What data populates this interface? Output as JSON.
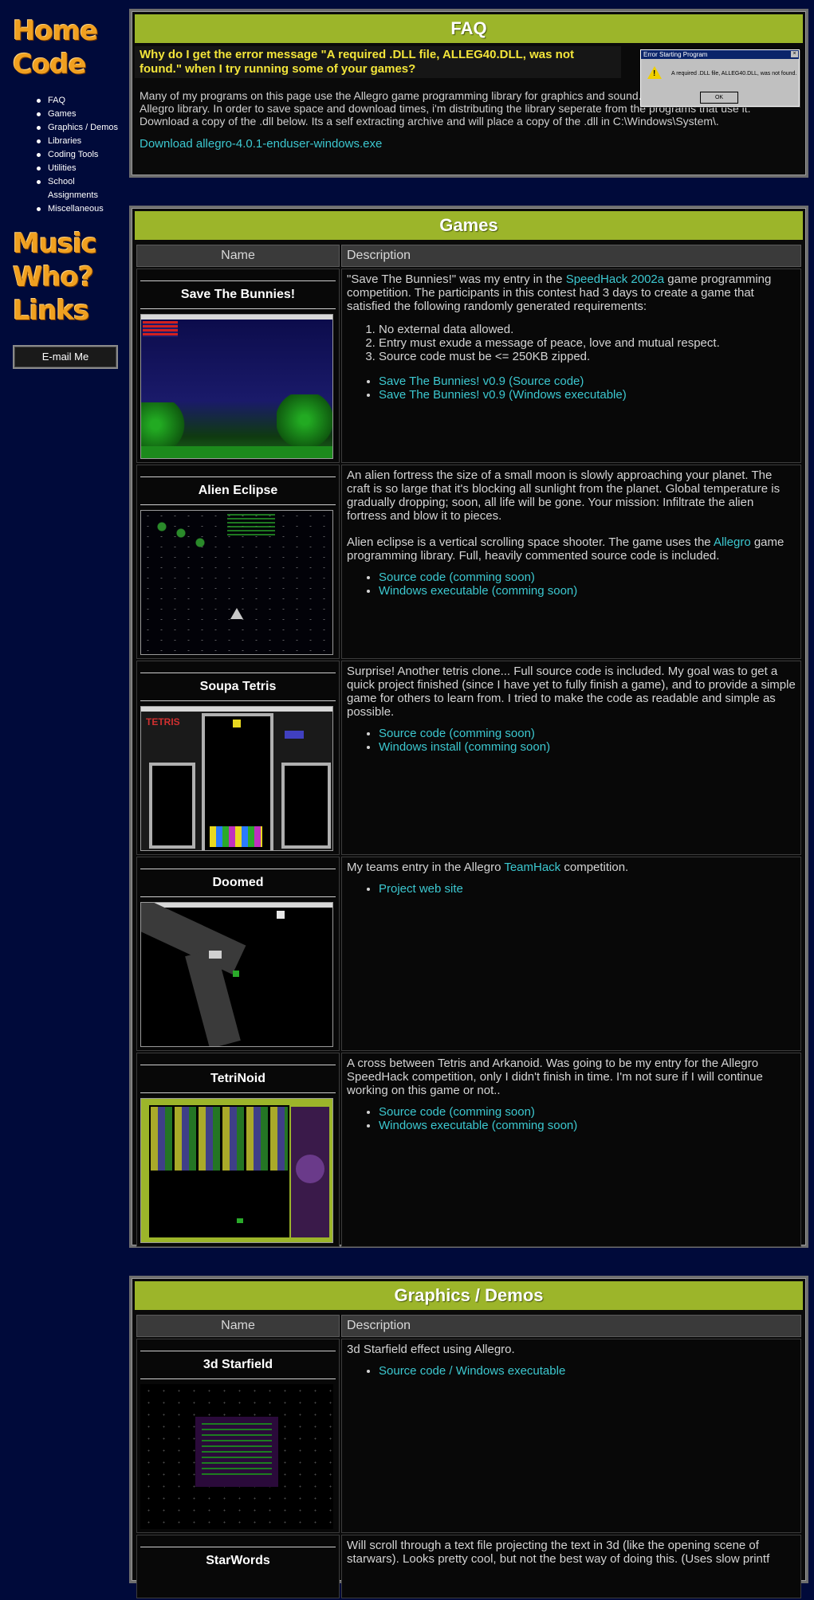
{
  "sidebar": {
    "logo_items": [
      "Home",
      "Code"
    ],
    "sub_items": [
      "FAQ",
      "Games",
      "Graphics / Demos",
      "Libraries",
      "Coding Tools",
      "Utilities",
      "School Assignments",
      "Miscellaneous"
    ],
    "logo_items2": [
      "Music",
      "Who?",
      "Links"
    ],
    "email_label": "E-mail Me"
  },
  "faq": {
    "header": "FAQ",
    "question": "Why do I get the error message \"A required .DLL file, ALLEG40.DLL, was not found.\" when I try running some of your games?",
    "answer": "Many of my programs on this page use the Allegro game programming library for graphics and sound. The file \"alleg40.dll\" is the Allegro library. In order to save space and download times, i'm distributing the library seperate from the programs that use it. Download a copy of the .dll below. Its a self extracting archive and will place a copy of the .dll in C:\\Windows\\System\\.",
    "download": "Download allegro-4.0.1-enduser-windows.exe",
    "dialog": {
      "title": "Error Starting Program",
      "message": "A required .DLL file, ALLEG40.DLL, was not found.",
      "ok": "OK"
    }
  },
  "games": {
    "header": "Games",
    "col_name": "Name",
    "col_desc": "Description",
    "rows": [
      {
        "name": "Save The Bunnies!",
        "p1_pre": "\"Save The Bunnies!\" was my entry in the ",
        "p1_link": "SpeedHack 2002a",
        "p1_post": " game programming competition. The participants in this contest had 3 days to create a game that satisfied the following randomly generated requirements:",
        "reqs": [
          "No external data allowed.",
          "Entry must exude a message of peace, love and mutual respect.",
          "Source code must be <= 250KB zipped."
        ],
        "links": [
          "Save The Bunnies! v0.9 (Source code)",
          "Save The Bunnies! v0.9 (Windows executable)"
        ]
      },
      {
        "name": "Alien Eclipse",
        "p1": "An alien fortress the size of a small moon is slowly approaching your planet. The craft is so large that it's blocking all sunlight from the planet. Global temperature is gradually dropping; soon, all life will be gone. Your mission: Infiltrate the alien fortress and blow it to pieces.",
        "p2_pre": "Alien eclipse is a vertical scrolling space shooter. The game uses the ",
        "p2_link": "Allegro",
        "p2_post": " game programming library. Full, heavily commented source code is included.",
        "links": [
          "Source code (comming soon)",
          "Windows executable (comming soon)"
        ]
      },
      {
        "name": "Soupa Tetris",
        "p1": "Surprise! Another tetris clone... Full source code is included. My goal was to get a quick project finished (since I have yet to fully finish a game), and to provide a simple game for others to learn from. I tried to make the code as readable and simple as possible.",
        "links": [
          "Source code (comming soon)",
          "Windows install (comming soon)"
        ]
      },
      {
        "name": "Doomed",
        "p1_pre": "My teams entry in the Allegro ",
        "p1_link": "TeamHack",
        "p1_post": " competition.",
        "links": [
          "Project web site"
        ]
      },
      {
        "name": "TetriNoid",
        "p1": "A cross between Tetris and Arkanoid. Was going to be my entry for the Allegro SpeedHack competition, only I didn't finish in time. I'm not sure if I will continue working on this game or not..",
        "links": [
          "Source code (comming soon)",
          "Windows executable (comming soon)"
        ]
      }
    ]
  },
  "graphics": {
    "header": "Graphics / Demos",
    "col_name": "Name",
    "col_desc": "Description",
    "rows": [
      {
        "name": "3d Starfield",
        "p1": "3d Starfield effect using Allegro.",
        "links": [
          "Source code / Windows executable"
        ]
      },
      {
        "name": "StarWords",
        "p1": "Will scroll through a text file projecting the text in 3d (like the opening scene of starwars). Looks pretty cool, but not the best way of doing this. (Uses slow printf"
      }
    ]
  },
  "colors": {
    "background": "#000a3a",
    "header_green": "#9cb52a",
    "link": "#3cc8d0",
    "question": "#f3e53a",
    "logo": "#f0a020"
  }
}
